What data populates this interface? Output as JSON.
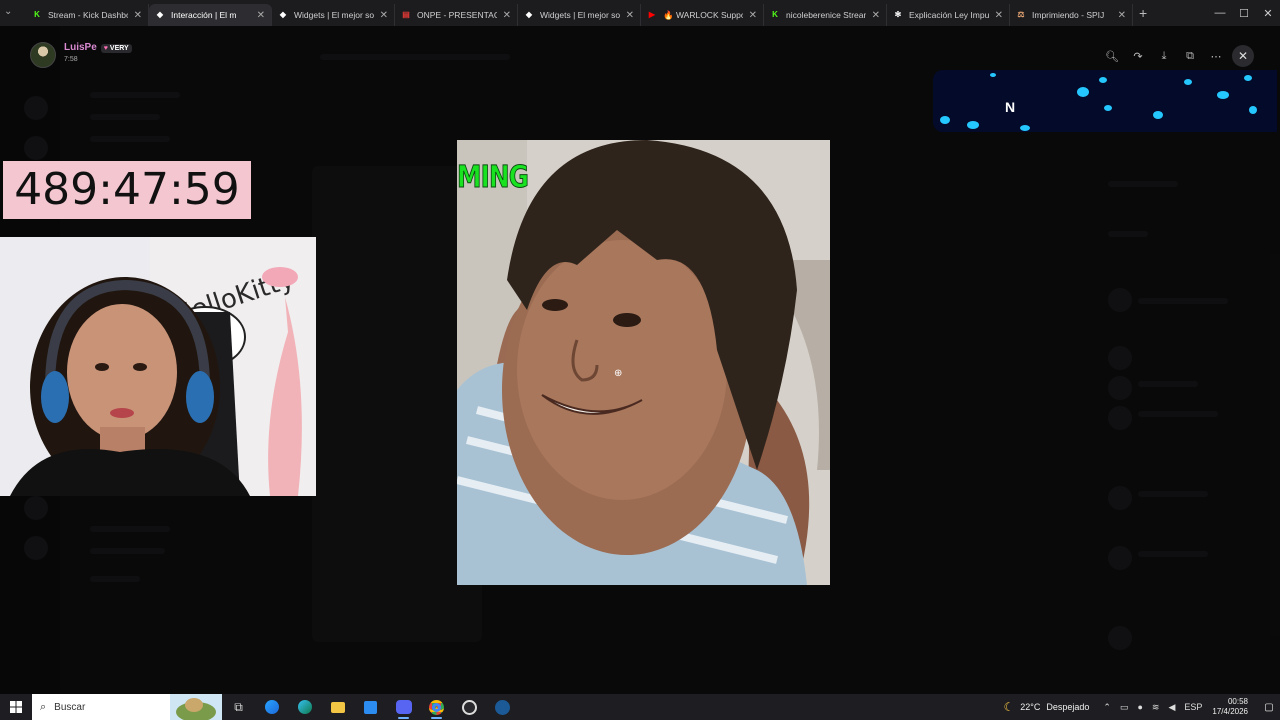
{
  "browser": {
    "tabs": [
      {
        "title": "Stream - Kick Dashbo",
        "icon": "kick-icon",
        "color": "#53fc18",
        "glyph": "K",
        "active": false
      },
      {
        "title": "Interacción | El m",
        "icon": "widget-icon",
        "color": "#ffffff",
        "glyph": "◆",
        "active": true
      },
      {
        "title": "Widgets | El mejor so",
        "icon": "widget-icon",
        "color": "#ffffff",
        "glyph": "◆",
        "active": false
      },
      {
        "title": "ONPE - PRESENTACIÓ",
        "icon": "document-icon",
        "color": "#e53935",
        "glyph": "▤",
        "active": false
      },
      {
        "title": "Widgets | El mejor so",
        "icon": "widget-icon",
        "color": "#ffffff",
        "glyph": "◆",
        "active": false
      },
      {
        "title": "🔥 WARLOCK Suppo",
        "icon": "youtube-icon",
        "color": "#ff0000",
        "glyph": "▶",
        "active": false
      },
      {
        "title": "nicoleberenice Strean",
        "icon": "kick-icon",
        "color": "#53fc18",
        "glyph": "K",
        "active": false
      },
      {
        "title": "Explicación Ley Impu",
        "icon": "chatgpt-icon",
        "color": "#ffffff",
        "glyph": "✻",
        "active": false
      },
      {
        "title": "Imprimiendo - SPIJ",
        "icon": "court-icon",
        "color": "#e0a070",
        "glyph": "⚖",
        "active": false
      }
    ],
    "new_tab": "+",
    "window_controls": {
      "minimize": "—",
      "maximize": "☐",
      "close": "✕"
    }
  },
  "viewer": {
    "username": "LuisPe",
    "badge": "VERY",
    "time": "7:58",
    "tools": [
      {
        "name": "zoom-icon",
        "glyph": "🔍︎"
      },
      {
        "name": "share-icon",
        "glyph": "↷"
      },
      {
        "name": "download-icon",
        "glyph": "⤓"
      },
      {
        "name": "open-external-icon",
        "glyph": "⧉"
      },
      {
        "name": "more-icon",
        "glyph": "⋯"
      }
    ],
    "close": "✕"
  },
  "overlay": {
    "timer": "489:47:59",
    "image_caption": "MING",
    "neon_letter": "N"
  },
  "taskbar": {
    "search_placeholder": "Buscar",
    "weather_temp": "22°C",
    "weather_desc": "Despejado",
    "language": "ESP",
    "time": "00:58",
    "date": "17/4/2026"
  },
  "colors": {
    "accent_pink": "#f3c6d0",
    "username": "#d98ad1",
    "caption_green": "#19e321"
  }
}
